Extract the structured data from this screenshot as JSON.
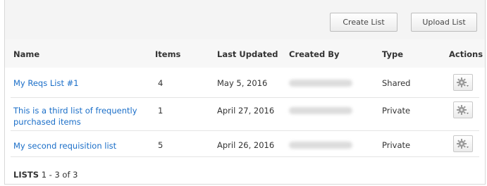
{
  "toolbar": {
    "create_label": "Create List",
    "upload_label": "Upload List"
  },
  "columns": [
    "Name",
    "Items",
    "Last Updated",
    "Created By",
    "Type",
    "Actions"
  ],
  "rows": [
    {
      "name": "My Reqs List #1",
      "items": "4",
      "updated": "May 5, 2016",
      "type": "Shared"
    },
    {
      "name": "This is a third list of frequently purchased items",
      "items": "1",
      "updated": "April 27, 2016",
      "type": "Private"
    },
    {
      "name": "My second requisition list",
      "items": "5",
      "updated": "April 26, 2016",
      "type": "Private"
    }
  ],
  "footer": {
    "label": "LISTS",
    "range": "1 - 3 of 3"
  },
  "icons": {
    "actions": "gear-icon"
  }
}
